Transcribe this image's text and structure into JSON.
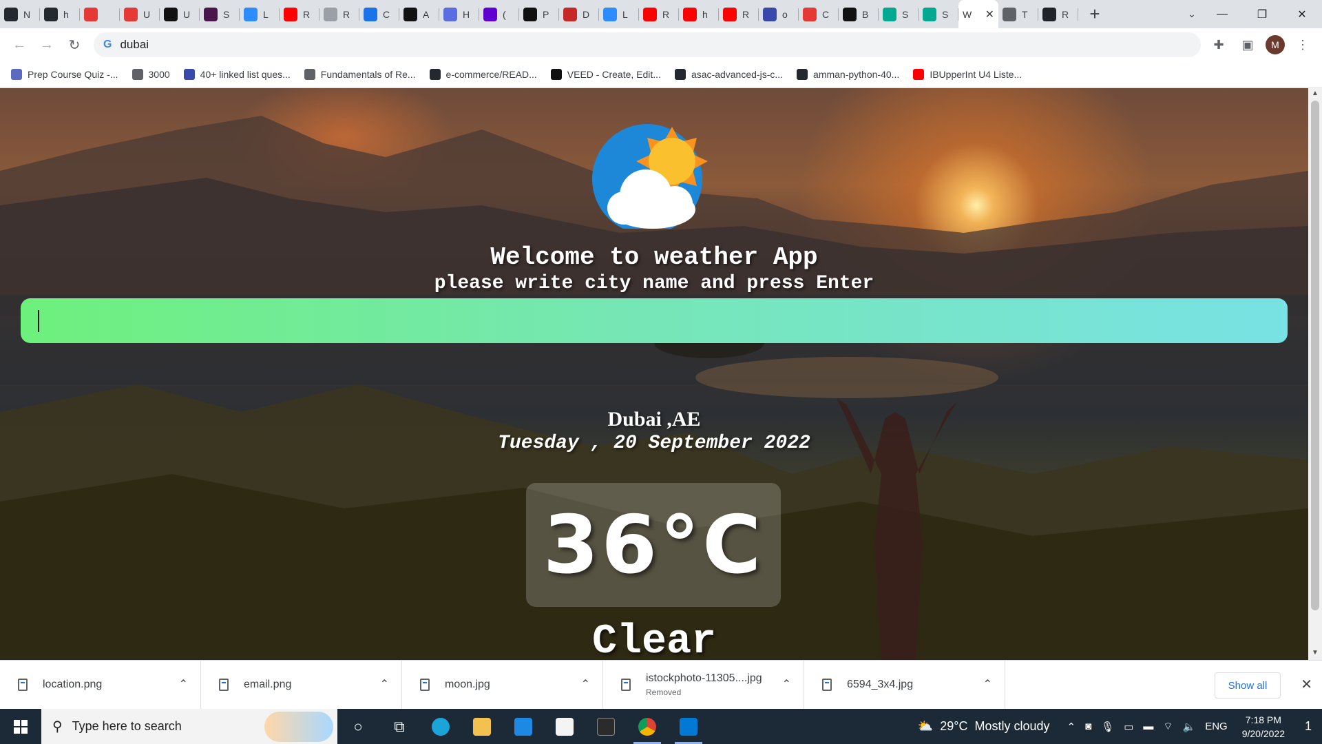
{
  "browser": {
    "tabs": [
      {
        "label": "N",
        "icon": "github-icon",
        "color": "#24292f"
      },
      {
        "label": "h",
        "icon": "github-icon",
        "color": "#24292f"
      },
      {
        "label": "",
        "icon": "score-icon",
        "color": "#e53935"
      },
      {
        "label": "U",
        "icon": "asterisk-icon",
        "color": "#e53935"
      },
      {
        "label": "U",
        "icon": "miro-icon",
        "color": "#111111"
      },
      {
        "label": "S",
        "icon": "slack-icon",
        "color": "#4a154b"
      },
      {
        "label": "L",
        "icon": "zoom-icon",
        "color": "#2d8cff"
      },
      {
        "label": "R",
        "icon": "youtube-icon",
        "color": "#ff0000"
      },
      {
        "label": "R",
        "icon": "feather-icon",
        "color": "#9aa0a6"
      },
      {
        "label": "C",
        "icon": "apps-icon",
        "color": "#1a73e8"
      },
      {
        "label": "A",
        "icon": "square-icon",
        "color": "#111111"
      },
      {
        "label": "H",
        "icon": "circle-icon",
        "color": "#5b6ee1"
      },
      {
        "label": "(",
        "icon": "mail-icon",
        "color": "#6001d2"
      },
      {
        "label": "P",
        "icon": "lambda-icon",
        "color": "#111111"
      },
      {
        "label": "D",
        "icon": "dict-icon",
        "color": "#c62828"
      },
      {
        "label": "L",
        "icon": "zoom-icon",
        "color": "#2d8cff"
      },
      {
        "label": "R",
        "icon": "youtube-icon",
        "color": "#ff0000"
      },
      {
        "label": "h",
        "icon": "youtube-icon",
        "color": "#ff0000"
      },
      {
        "label": "R",
        "icon": "youtube-icon",
        "color": "#ff0000"
      },
      {
        "label": "o",
        "icon": "slashes-icon",
        "color": "#3949ab"
      },
      {
        "label": "C",
        "icon": "figure-icon",
        "color": "#e53935"
      },
      {
        "label": "B",
        "icon": "lambda-icon",
        "color": "#111111"
      },
      {
        "label": "S",
        "icon": "diamond-icon",
        "color": "#00a98f"
      },
      {
        "label": "S",
        "icon": "diamond-icon",
        "color": "#00a98f"
      },
      {
        "label": "W",
        "icon": "none",
        "color": "#ffffff",
        "active": true
      },
      {
        "label": "T",
        "icon": "globe-icon",
        "color": "#5f6368"
      },
      {
        "label": "R",
        "icon": "react-icon",
        "color": "#20232a"
      }
    ],
    "address": "dubai",
    "profile_initial": "M",
    "bookmarks": [
      {
        "label": "Prep Course Quiz -...",
        "color": "#5c6bc0"
      },
      {
        "label": "3000",
        "color": "#5f6368"
      },
      {
        "label": "40+ linked list ques...",
        "color": "#3949ab"
      },
      {
        "label": "Fundamentals of Re...",
        "color": "#5f6368"
      },
      {
        "label": "e-commerce/READ...",
        "color": "#24292f"
      },
      {
        "label": "VEED - Create, Edit...",
        "color": "#111111"
      },
      {
        "label": "asac-advanced-js-c...",
        "color": "#24292f"
      },
      {
        "label": "amman-python-40...",
        "color": "#24292f"
      },
      {
        "label": "IBUpperInt U4 Liste...",
        "color": "#ff0000"
      }
    ]
  },
  "app": {
    "title": "Welcome to weather App",
    "subtitle": "please write city name and press Enter",
    "input_value": "",
    "city": "Dubai ,AE",
    "date": "Tuesday , 20 September 2022",
    "temperature": "36°C",
    "condition": "Clear"
  },
  "downloads": {
    "items": [
      {
        "name": "location.png",
        "sub": ""
      },
      {
        "name": "email.png",
        "sub": ""
      },
      {
        "name": "moon.jpg",
        "sub": ""
      },
      {
        "name": "istockphoto-11305....jpg",
        "sub": "Removed"
      },
      {
        "name": "6594_3x4.jpg",
        "sub": ""
      }
    ],
    "show_all": "Show all"
  },
  "taskbar": {
    "search_placeholder": "Type here to search",
    "weather_temp": "29°C",
    "weather_text": "Mostly cloudy",
    "language": "ENG",
    "time": "7:18 PM",
    "date": "9/20/2022",
    "notification_count": "1"
  }
}
